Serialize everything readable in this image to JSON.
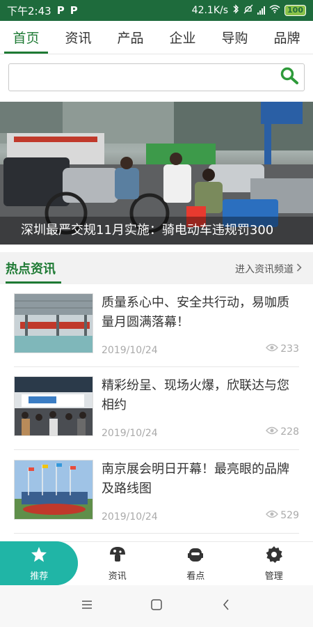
{
  "status": {
    "time": "下午2:43",
    "app_icons": [
      "P",
      "P"
    ],
    "speed": "42.1K/s",
    "battery": "100"
  },
  "tabs": [
    {
      "label": "首页",
      "active": true
    },
    {
      "label": "资讯",
      "active": false
    },
    {
      "label": "产品",
      "active": false
    },
    {
      "label": "企业",
      "active": false
    },
    {
      "label": "导购",
      "active": false
    },
    {
      "label": "品牌",
      "active": false
    }
  ],
  "search": {
    "value": "",
    "placeholder": ""
  },
  "banner": {
    "caption": "深圳最严交规11月实施：骑电动车违规罚300"
  },
  "hot_news": {
    "title": "热点资讯",
    "more_label": "进入资讯频道",
    "items": [
      {
        "title": "质量系心中、安全共行动，易咖质量月圆满落幕！",
        "date": "2019/10/24",
        "views": "233"
      },
      {
        "title": "精彩纷呈、现场火爆，欣联达与您相约",
        "date": "2019/10/24",
        "views": "228"
      },
      {
        "title": "南京展会明日开幕！最亮眼的品牌及路线图",
        "date": "2019/10/24",
        "views": "529"
      }
    ]
  },
  "bottom_nav": [
    {
      "label": "推荐",
      "icon": "star-icon",
      "active": true
    },
    {
      "label": "资讯",
      "icon": "mushroom-icon",
      "active": false
    },
    {
      "label": "看点",
      "icon": "robot-icon",
      "active": false
    },
    {
      "label": "管理",
      "icon": "gear-icon",
      "active": false
    }
  ],
  "colors": {
    "status_bar": "#1e6b3c",
    "accent": "#1e7a34",
    "nav_active": "#20b5a6"
  }
}
